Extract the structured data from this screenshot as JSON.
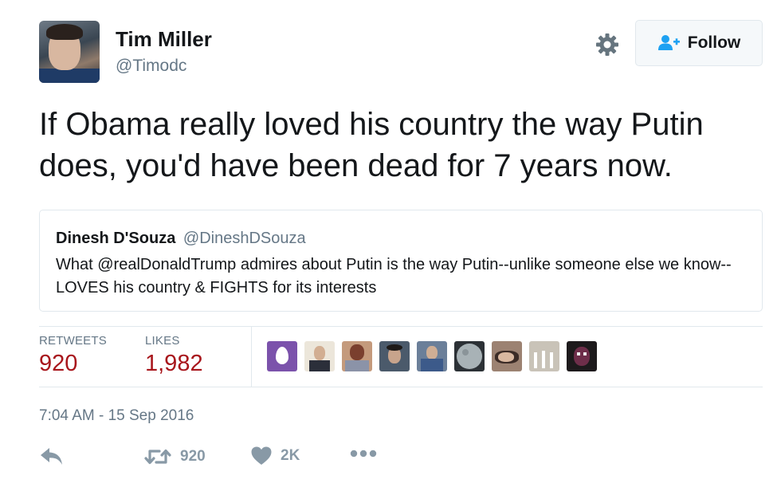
{
  "author": {
    "name": "Tim Miller",
    "handle": "@Timodc"
  },
  "follow_button": {
    "label": "Follow",
    "icon": "person-plus-icon"
  },
  "settings_icon": "gear-icon",
  "tweet_text": "If Obama really loved his country the way Putin does, you'd have been dead for 7 years now.",
  "quoted_tweet": {
    "name": "Dinesh D'Souza",
    "handle": "@DineshDSouza",
    "text": "What @realDonaldTrump admires about Putin is the way Putin--unlike someone else we know--LOVES his country & FIGHTS for its interests"
  },
  "stats": {
    "retweets_label": "RETWEETS",
    "retweets_value": "920",
    "likes_label": "LIKES",
    "likes_value": "1,982"
  },
  "liker_avatars": [
    {
      "name": "egg-avatar",
      "color": "#7b52ab"
    },
    {
      "name": "liker-avatar-2",
      "color": "#c9b79c"
    },
    {
      "name": "liker-avatar-3",
      "color": "#8a5a4a"
    },
    {
      "name": "liker-avatar-4",
      "color": "#3b4a5c"
    },
    {
      "name": "liker-avatar-5",
      "color": "#5b6f8a"
    },
    {
      "name": "liker-avatar-6",
      "color": "#9aa5a8"
    },
    {
      "name": "liker-avatar-7",
      "color": "#6a5248"
    },
    {
      "name": "liker-avatar-8",
      "color": "#b7b0a5"
    },
    {
      "name": "liker-avatar-9",
      "color": "#2a1f24"
    }
  ],
  "timestamp": "7:04 AM - 15 Sep 2016",
  "actions": {
    "reply_icon": "reply-icon",
    "retweet_icon": "retweet-icon",
    "retweet_count": "920",
    "like_icon": "heart-icon",
    "like_count": "2K",
    "more_icon": "more-dots-icon"
  },
  "colors": {
    "stat_value": "#a8161c",
    "muted_text": "#657786",
    "follow_icon": "#1da1f2",
    "action_icon": "#8899a6",
    "border": "#e1e8ed"
  }
}
